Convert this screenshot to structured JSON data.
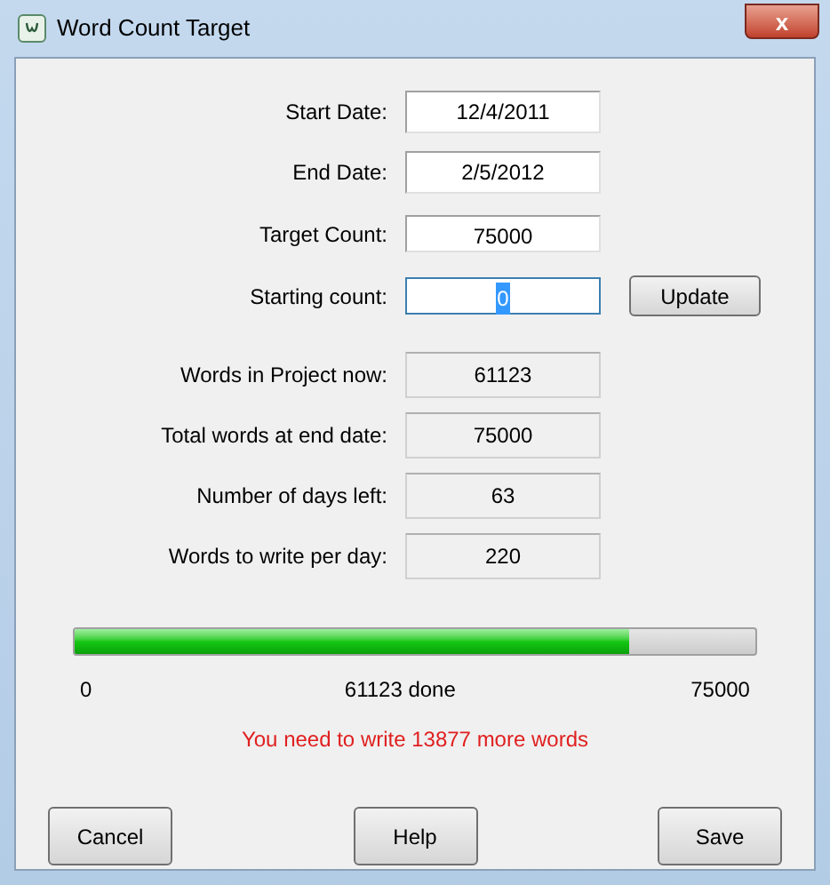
{
  "window": {
    "title": "Word Count Target",
    "close": "x"
  },
  "inputs": [
    {
      "label": "Start Date:",
      "value": "12/4/2011",
      "focused": false
    },
    {
      "label": "End Date:",
      "value": "2/5/2012",
      "focused": false
    },
    {
      "label": "Target Count:",
      "value": "75000",
      "focused": false
    },
    {
      "label": "Starting count:",
      "value": "0",
      "focused": true
    }
  ],
  "update_button": "Update",
  "readouts": [
    {
      "label": "Words in Project now:",
      "value": "61123"
    },
    {
      "label": "Total words at end date:",
      "value": "75000"
    },
    {
      "label": "Number of days left:",
      "value": "63"
    },
    {
      "label": "Words to write per day:",
      "value": "220"
    }
  ],
  "progress": {
    "level": 0.815,
    "min": "0",
    "done": "61123 done",
    "max": "75000"
  },
  "message": "You need to write 13877 more words",
  "buttons": [
    "Cancel",
    "Help",
    "Save"
  ]
}
